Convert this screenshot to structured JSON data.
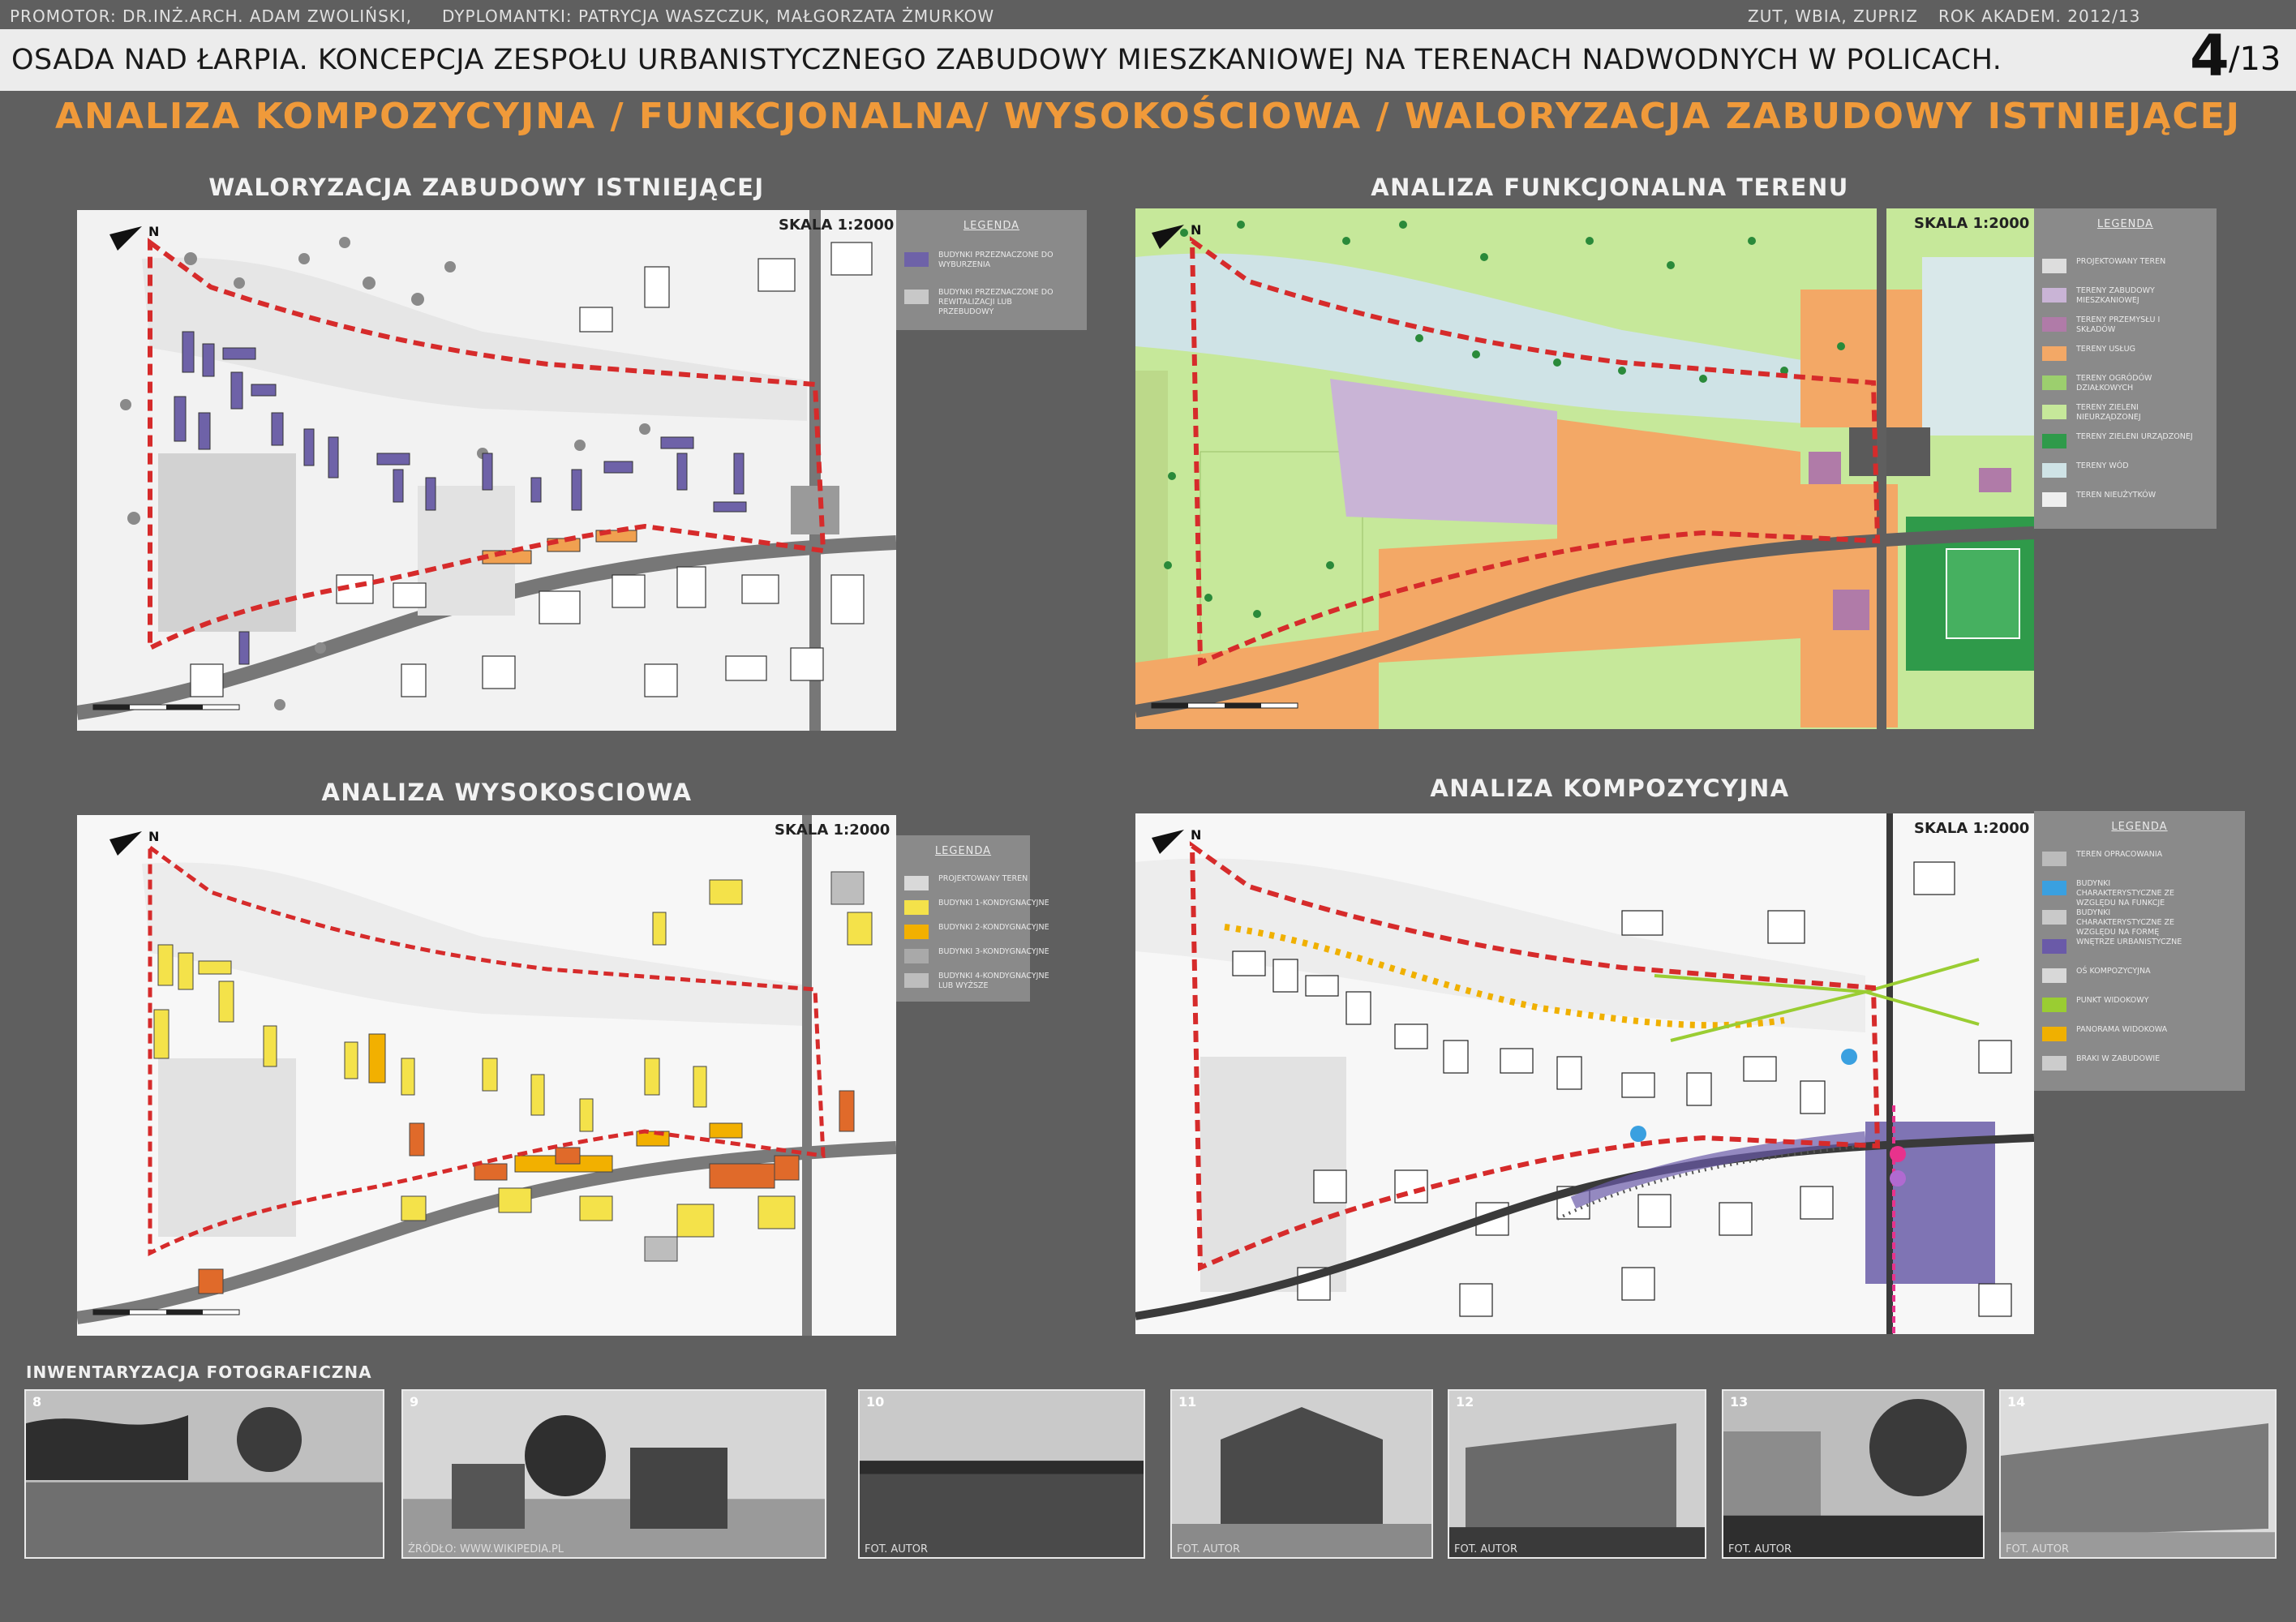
{
  "header": {
    "promotor": "PROMOTOR: DR.INŻ.ARCH. ADAM ZWOLIŃSKI,",
    "dyplomantki": "DYPLOMANTKI: PATRYCJA WASZCZUK, MAŁGORZATA ŻMURKOW",
    "institution": "ZUT, WBIA, ZUPRIZ",
    "year": "ROK AKADEM. 2012/13",
    "title": "OSADA NAD ŁARPIA. KONCEPCJA ZESPOŁU URBANISTYCZNEGO ZABUDOWY MIESZKANIOWEJ NA TERENACH NADWODNYCH W POLICACH.",
    "page_number": "4",
    "page_total": "/13",
    "subtitle": "ANALIZA KOMPOZYCYJNA / FUNKCJONALNA/ WYSOKOŚCIOWA / WALORYZACJA ZABUDOWY ISTNIEJĄCEJ"
  },
  "panels": {
    "waloryzacja": {
      "title": "WALORYZACJA ZABUDOWY ISTNIEJĄCEJ",
      "scale": "SKALA 1:2000",
      "legend_title": "LEGENDA",
      "legend": [
        {
          "label": "BUDYNKI PRZEZNACZONE DO WYBURZENIA",
          "color": "#6e62a8"
        },
        {
          "label": "BUDYNKI PRZEZNACZONE DO REWITALIZACJI LUB PRZEBUDOWY",
          "color": "#c8c8c8"
        }
      ]
    },
    "funkcjonalna": {
      "title": "ANALIZA FUNKCJONALNA TERENU",
      "scale": "SKALA 1:2000",
      "legend_title": "LEGENDA",
      "legend": [
        {
          "label": "PROJEKTOWANY TEREN",
          "color": "#dddddd"
        },
        {
          "label": "TERENY ZABUDOWY MIESZKANIOWEJ",
          "color": "#c9b4d6"
        },
        {
          "label": "TERENY PRZEMYSŁU I SKŁADÓW",
          "color": "#b07ba8"
        },
        {
          "label": "TERENY USŁUG",
          "color": "#f3a866"
        },
        {
          "label": "TERENY OGRÓDÓW DZIAŁKOWYCH",
          "color": "#9ccf6e"
        },
        {
          "label": "TERENY ZIELENI NIEURZĄDZONEJ",
          "color": "#c6e89a"
        },
        {
          "label": "TERENY ZIELENI URZĄDZONEJ",
          "color": "#2f9a4a"
        },
        {
          "label": "TERENY WÓD",
          "color": "#cfe3e6"
        },
        {
          "label": "TEREN NIEUŻYTKÓW",
          "color": "#efefef"
        }
      ]
    },
    "wysokosciowa": {
      "title": "ANALIZA WYSOKOSCIOWA",
      "scale": "SKALA 1:2000",
      "legend_title": "LEGENDA",
      "legend": [
        {
          "label": "PROJEKTOWANY TEREN",
          "color": "#d9d9d9"
        },
        {
          "label": "BUDYNKI 1-KONDYGNACYJNE",
          "color": "#f4e24a"
        },
        {
          "label": "BUDYNKI 2-KONDYGNACYJNE",
          "color": "#f2b000"
        },
        {
          "label": "BUDYNKI 3-KONDYGNACYJNE",
          "color": "#a9a9a9"
        },
        {
          "label": "BUDYNKI 4-KONDYGNACYJNE LUB WYŻSZE",
          "color": "#bdbdbd"
        }
      ]
    },
    "kompozycyjna": {
      "title": "ANALIZA KOMPOZYCYJNA",
      "scale": "SKALA 1:2000",
      "legend_title": "LEGENDA",
      "legend": [
        {
          "label": "TEREN OPRACOWANIA",
          "color": "#bbbbbb"
        },
        {
          "label": "BUDYNKI CHARAKTERYSTYCZNE ZE WZGLĘDU NA FUNKCJE",
          "color": "#3aa0e0"
        },
        {
          "label": "BUDYNKI CHARAKTERYSTYCZNE ZE WZGLĘDU NA FORMĘ",
          "color": "#c9c9c9"
        },
        {
          "label": "WNĘTRZE URBANISTYCZNE",
          "color": "#6a5aa8"
        },
        {
          "label": "OŚ KOMPOZYCYJNA",
          "color": "#d8d8d8"
        },
        {
          "label": "PUNKT WIDOKOWY",
          "color": "#9acd32"
        },
        {
          "label": "PANORAMA WIDOKOWA",
          "color": "#f0b000"
        },
        {
          "label": "BRAKI W ZABUDOWIE",
          "color": "#cccccc"
        }
      ]
    }
  },
  "photos": {
    "label": "INWENTARYZACJA FOTOGRAFICZNA",
    "items": [
      {
        "num": "8",
        "caption": "",
        "scene": "river"
      },
      {
        "num": "9",
        "caption": "ŹRÓDŁO: WWW.WIKIPEDIA.PL",
        "scene": "town"
      },
      {
        "num": "10",
        "caption": "FOT. AUTOR",
        "scene": "lake"
      },
      {
        "num": "11",
        "caption": "FOT. AUTOR",
        "scene": "house"
      },
      {
        "num": "12",
        "caption": "FOT. AUTOR",
        "scene": "blocks"
      },
      {
        "num": "13",
        "caption": "FOT. AUTOR",
        "scene": "fence"
      },
      {
        "num": "14",
        "caption": "FOT. AUTOR",
        "scene": "street"
      }
    ]
  }
}
